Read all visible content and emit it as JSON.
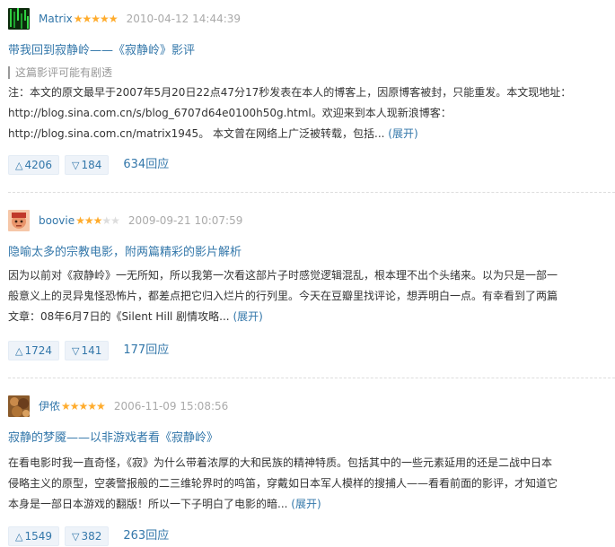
{
  "reviews": [
    {
      "author": "Matrix",
      "stars": "★★★★★",
      "stars_off": "",
      "date": "2010-04-12 14:44:39",
      "title": "带我回到寂静岭——《寂静岭》影评",
      "spoiler": "这篇影评可能有剧透",
      "lines": [
        "注：本文的原文最早于2007年5月20日22点47分17秒发表在本人的博客上，因原博客被封，只能重发。本文现地址：",
        "http://blog.sina.com.cn/s/blog_6707d64e0100h50g.html。欢迎来到本人现新浪博客：",
        "http://blog.sina.com.cn/matrix1945。 本文曾在网络上广泛被转载，包括..."
      ],
      "expand": "(展开)",
      "up": "4206",
      "down": "184",
      "replies": "634回应"
    },
    {
      "author": "boovie",
      "stars": "★★★",
      "stars_off": "★★",
      "date": "2009-09-21 10:07:59",
      "title": "隐喻太多的宗教电影，附两篇精彩的影片解析",
      "lines": [
        "因为以前对《寂静岭》一无所知，所以我第一次看这部片子时感觉逻辑混乱，根本理不出个头绪来。以为只是一部一",
        "般意义上的灵异鬼怪恐怖片，都差点把它归入烂片的行列里。今天在豆瓣里找评论，想弄明白一点。有幸看到了两篇",
        "文章：08年6月7日的《Silent Hill 剧情攻略..."
      ],
      "expand": "(展开)",
      "up": "1724",
      "down": "141",
      "replies": "177回应"
    },
    {
      "author": "伊侬",
      "stars": "★★★★★",
      "stars_off": "",
      "date": "2006-11-09 15:08:56",
      "title": "寂静的梦魇——以非游戏者看《寂静岭》",
      "lines": [
        "在看电影时我一直奇怪，《寂》为什么带着浓厚的大和民族的精神特质。包括其中的一些元素延用的还是二战中日本",
        "侵略主义的原型，空袭警报般的二三维轮界时的鸣笛，穿戴如日本军人模样的搜捕人——看看前面的影评，才知道它",
        "本身是一部日本游戏的翻版！所以一下子明白了电影的暗..."
      ],
      "expand": "(展开)",
      "up": "1549",
      "down": "382",
      "replies": "263回应"
    }
  ],
  "icons": {
    "upvote": "triangle-up-icon",
    "downvote": "triangle-down-icon"
  },
  "colors": {
    "link": "#3377aa",
    "star": "#ffac2d",
    "vote_bg": "#eef3f9"
  }
}
